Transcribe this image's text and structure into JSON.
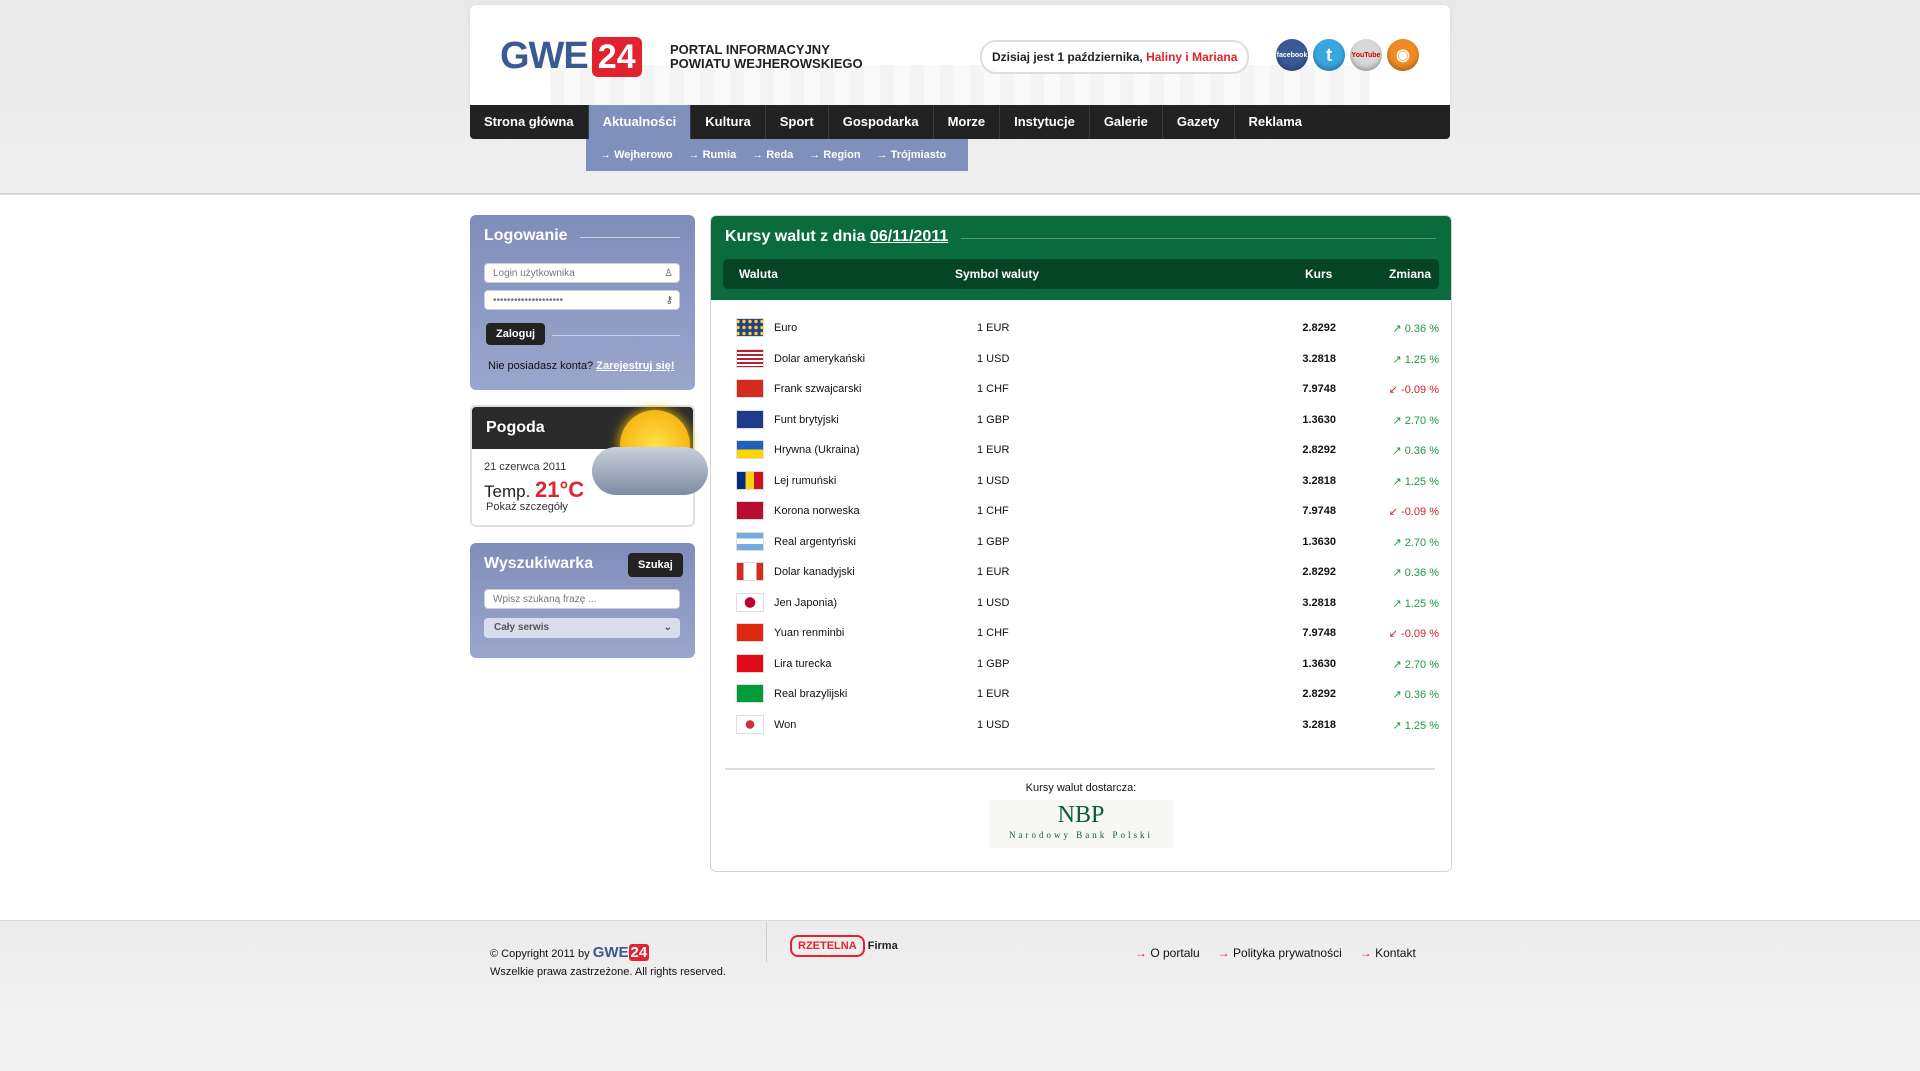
{
  "header": {
    "logo_text": "GWE",
    "logo_num": "24",
    "tagline1": "PORTAL INFORMACYJNY",
    "tagline2": "POWIATU WEJHEROWSKIEGO",
    "date_prefix": "Dzisiaj jest 1 października, ",
    "date_names": "Haliny i Mariana",
    "social": {
      "facebook": "facebook",
      "twitter": "t",
      "youtube": "YouTube",
      "rss": "◉"
    }
  },
  "nav": {
    "items": [
      "Strona główna",
      "Aktualności",
      "Kultura",
      "Sport",
      "Gospodarka",
      "Morze",
      "Instytucje",
      "Galerie",
      "Gazety",
      "Reklama"
    ],
    "active_index": 1,
    "sub": [
      "Wejherowo",
      "Rumia",
      "Reda",
      "Region",
      "Trójmiasto"
    ]
  },
  "login": {
    "title": "Logowanie",
    "user_placeholder": "Login użytkownika",
    "password_mask": "••••••••••••••••••••",
    "submit": "Zaloguj",
    "no_account": "Nie posiadasz konta? ",
    "register": "Zarejestruj się!"
  },
  "weather": {
    "title": "Pogoda",
    "date": "21 czerwca 2011",
    "temp_label": "Temp. ",
    "temp_value": "21°C",
    "details": "Pokaż szczegóły"
  },
  "search": {
    "title": "Wyszukiwarka",
    "button": "Szukaj",
    "placeholder": "Wpisz szukaną frazę ...",
    "scope": "Cały serwis"
  },
  "rates": {
    "title_prefix": "Kursy walut z dnia ",
    "title_date": "06/11/2011",
    "headers": {
      "currency": "Waluta",
      "symbol": "Symbol waluty",
      "rate": "Kurs",
      "change": "Zmiana"
    },
    "rows": [
      {
        "name": "Euro",
        "symbol": "1 EUR",
        "rate": "2.8292",
        "change": "0.36 %",
        "dir": "up",
        "flag": "eu"
      },
      {
        "name": "Dolar amerykański",
        "symbol": "1 USD",
        "rate": "3.2818",
        "change": "1.25 %",
        "dir": "up",
        "flag": "us"
      },
      {
        "name": "Frank szwajcarski",
        "symbol": "1 CHF",
        "rate": "7.9748",
        "change": "-0.09 %",
        "dir": "dn",
        "flag": "ch"
      },
      {
        "name": "Funt brytyjski",
        "symbol": "1 GBP",
        "rate": "1.3630",
        "change": "2.70 %",
        "dir": "up",
        "flag": "gb"
      },
      {
        "name": "Hrywna (Ukraina)",
        "symbol": "1 EUR",
        "rate": "2.8292",
        "change": "0.36 %",
        "dir": "up",
        "flag": "ua"
      },
      {
        "name": "Lej rumuński",
        "symbol": "1 USD",
        "rate": "3.2818",
        "change": "1.25 %",
        "dir": "up",
        "flag": "ro"
      },
      {
        "name": "Korona norweska",
        "symbol": "1 CHF",
        "rate": "7.9748",
        "change": "-0.09 %",
        "dir": "dn",
        "flag": "no"
      },
      {
        "name": "Real argentyński",
        "symbol": "1 GBP",
        "rate": "1.3630",
        "change": "2.70 %",
        "dir": "up",
        "flag": "ar"
      },
      {
        "name": "Dolar kanadyjski",
        "symbol": "1 EUR",
        "rate": "2.8292",
        "change": "0.36 %",
        "dir": "up",
        "flag": "ca"
      },
      {
        "name": "Jen Japonia)",
        "symbol": "1 USD",
        "rate": "3.2818",
        "change": "1.25 %",
        "dir": "up",
        "flag": "jp"
      },
      {
        "name": "Yuan renminbi",
        "symbol": "1 CHF",
        "rate": "7.9748",
        "change": "-0.09 %",
        "dir": "dn",
        "flag": "cn"
      },
      {
        "name": "Lira turecka",
        "symbol": "1 GBP",
        "rate": "1.3630",
        "change": "2.70 %",
        "dir": "up",
        "flag": "tr"
      },
      {
        "name": "Real brazylijski",
        "symbol": "1 EUR",
        "rate": "2.8292",
        "change": "0.36 %",
        "dir": "up",
        "flag": "br"
      },
      {
        "name": "Won",
        "symbol": "1 USD",
        "rate": "3.2818",
        "change": "1.25 %",
        "dir": "up",
        "flag": "kr"
      }
    ],
    "provider_label": "Kursy walut dostarcza:",
    "provider_logo": "NBP",
    "provider_name": "Narodowy Bank Polski"
  },
  "footer": {
    "copyright": "© Copyright 2011 by ",
    "rights": "Wszelkie prawa zastrzeżone. All rights reserved.",
    "badge_a": "RZETELNA",
    "badge_b": " Firma",
    "links": [
      "O portalu",
      "Polityka prywatności",
      "Kontakt"
    ]
  },
  "colors": {
    "brand_blue": "#3a5a93",
    "brand_red": "#e3222f",
    "panel_green": "#0a6b3c",
    "nav_active": "#7f90bc"
  }
}
